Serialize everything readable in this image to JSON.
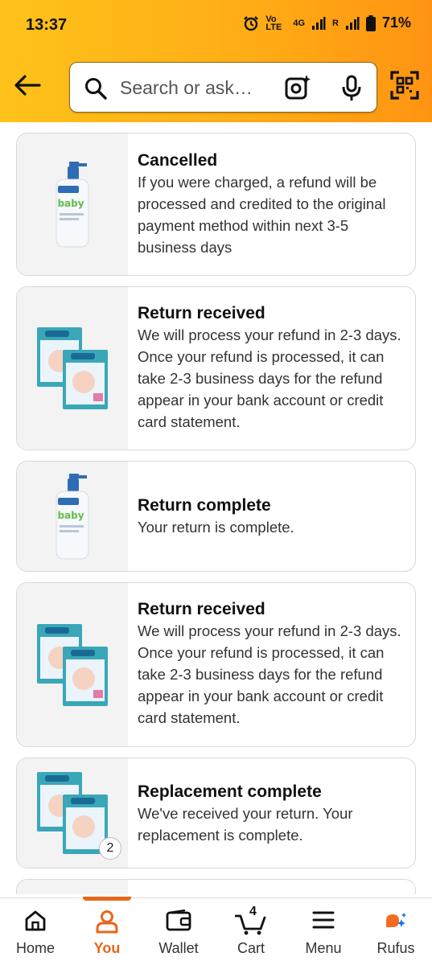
{
  "status_bar": {
    "time": "13:37",
    "network_label_1": "Vo LTE",
    "network_label_2": "4G",
    "network_label_3": "R",
    "battery": "71%"
  },
  "search": {
    "placeholder": "Search or ask…"
  },
  "cards": [
    {
      "title": "Cancelled",
      "text": "If you were charged, a refund will be processed and credited to the original payment method within next 3-5 business days",
      "image": "moisturizer-bottle"
    },
    {
      "title": "Return received",
      "text": "We will process your refund in 2-3 days. Once your refund is processed, it can take 2-3 business days for the refund appear in your bank account or credit card statement.",
      "image": "diaper-boxes"
    },
    {
      "title": "Return complete",
      "text": "Your return is complete.",
      "image": "moisturizer-bottle"
    },
    {
      "title": "Return received",
      "text": "We will process your refund in 2-3 days. Once your refund is processed, it can take 2-3 business days for the refund appear in your bank account or credit card statement.",
      "image": "diaper-boxes"
    },
    {
      "title": "Replacement complete",
      "text": "We've received your return. Your replacement is complete.",
      "image": "diaper-boxes",
      "badge": "2"
    }
  ],
  "nav": {
    "items": [
      {
        "label": "Home",
        "icon": "home-icon"
      },
      {
        "label": "You",
        "icon": "user-icon",
        "active": true
      },
      {
        "label": "Wallet",
        "icon": "wallet-icon"
      },
      {
        "label": "Cart",
        "icon": "cart-icon",
        "count": "4"
      },
      {
        "label": "Menu",
        "icon": "menu-icon"
      },
      {
        "label": "Rufus",
        "icon": "rufus-icon"
      }
    ]
  },
  "colors": {
    "header_start": "#ffc21a",
    "header_end": "#ff9412",
    "accent": "#e8661a",
    "bottle_blue": "#2e6db5",
    "box_teal": "#3aa7b8"
  }
}
